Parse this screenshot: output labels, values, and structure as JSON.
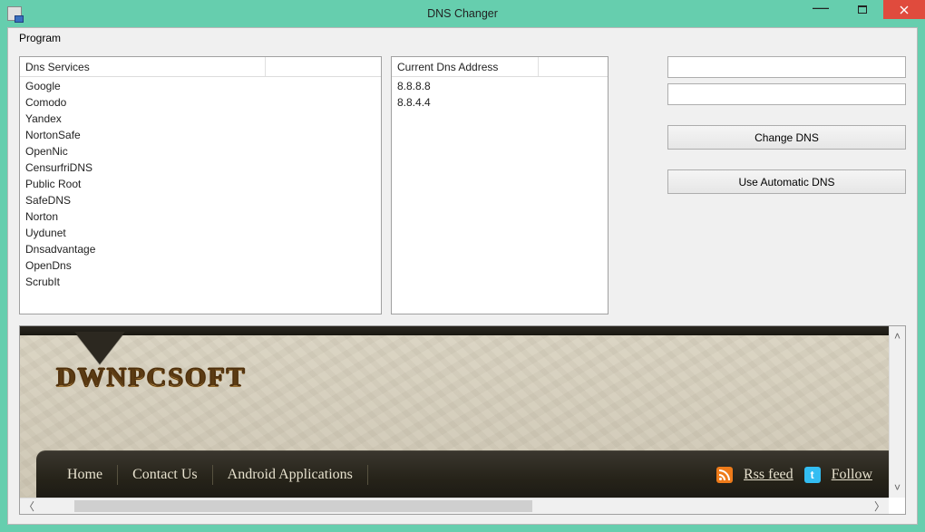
{
  "window": {
    "title": "DNS Changer"
  },
  "menubar": {
    "program": "Program"
  },
  "panels": {
    "services_header": "Dns Services",
    "current_header": "Current Dns Address"
  },
  "services": [
    "Google",
    "Comodo",
    "Yandex",
    "NortonSafe",
    "OpenNic",
    "CensurfriDNS",
    "Public Root",
    "SafeDNS",
    "Norton",
    "Uydunet",
    "Dnsadvantage",
    "OpenDns",
    "ScrubIt"
  ],
  "current_dns": [
    "8.8.8.8",
    "8.8.4.4"
  ],
  "inputs": {
    "dns1": "",
    "dns2": ""
  },
  "buttons": {
    "change": "Change DNS",
    "auto": "Use Automatic DNS"
  },
  "web": {
    "logo": "DWNPCSOFT",
    "nav": {
      "home": "Home",
      "contact": "Contact Us",
      "android": "Android Applications",
      "rss": "Rss feed",
      "follow": "Follow"
    }
  }
}
